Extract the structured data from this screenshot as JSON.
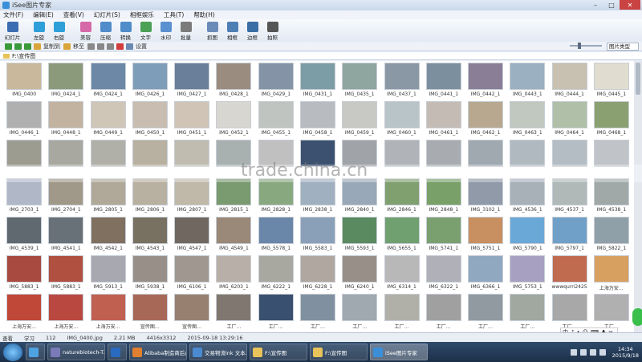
{
  "window": {
    "title": "iSee图片专家"
  },
  "window_buttons": [
    "–",
    "□",
    "✕"
  ],
  "menu": [
    "文件(F)",
    "编辑(E)",
    "查看(V)",
    "幻灯片(S)",
    "相框娱乐",
    "工具(T)",
    "帮助(H)"
  ],
  "toolbar": [
    {
      "label": "幻灯片",
      "color": "#3c6db2"
    },
    {
      "label": "左旋",
      "color": "#2e9fd8"
    },
    {
      "label": "右旋",
      "color": "#2e9fd8"
    },
    {
      "label": "美容",
      "color": "#d66aa8"
    },
    {
      "label": "压缩",
      "color": "#4f8cc9"
    },
    {
      "label": "转换",
      "color": "#4f8cc9"
    },
    {
      "label": "文字",
      "color": "#4aa055"
    },
    {
      "label": "水印",
      "color": "#5a8fd0"
    },
    {
      "label": "批量",
      "color": "#7b7b7b"
    },
    {
      "label": "抓图",
      "color": "#6a8bb8"
    },
    {
      "label": "相框",
      "color": "#4d7fb5"
    },
    {
      "label": "边框",
      "color": "#3a6ea5"
    },
    {
      "label": "拍照",
      "color": "#555"
    }
  ],
  "subtoolbar": [
    {
      "label": "",
      "icon": "back-arrow-icon",
      "color": "#3a9a3a"
    },
    {
      "label": "",
      "icon": "forward-arrow-icon",
      "color": "#3a9a3a"
    },
    {
      "label": "",
      "icon": "up-arrow-icon",
      "color": "#3a9a3a"
    },
    {
      "label": "复制到",
      "icon": "copy-icon",
      "color": "#d9a43a"
    },
    {
      "label": "移至",
      "icon": "move-icon",
      "color": "#d9a43a"
    },
    {
      "label": "",
      "icon": "cut-icon",
      "color": "#888"
    },
    {
      "label": "",
      "icon": "paste-icon",
      "color": "#888"
    },
    {
      "label": "",
      "icon": "copy2-icon",
      "color": "#888"
    },
    {
      "label": "",
      "icon": "delete-icon",
      "color": "#d23c3c"
    },
    {
      "label": "设置",
      "icon": "settings-icon",
      "color": "#6b8ab2"
    }
  ],
  "sort_select": "图片类型",
  "path": "F:\\宣传图",
  "thumbnails": [
    {
      "cap": "IMG_0400",
      "color": "#c9b89b"
    },
    {
      "cap": "IMG_0424_1",
      "color": "#8b9a7a"
    },
    {
      "cap": "IMG_0424_1",
      "color": "#6c88a6"
    },
    {
      "cap": "IMG_0426_1",
      "color": "#7d9db8"
    },
    {
      "cap": "IMG_0427_1",
      "color": "#6a7f9a"
    },
    {
      "cap": "IMG_0428_1",
      "color": "#9a8d80"
    },
    {
      "cap": "IMG_0429_1",
      "color": "#8494a6"
    },
    {
      "cap": "IMG_0431_1",
      "color": "#7d9da6"
    },
    {
      "cap": "IMG_0435_1",
      "color": "#8fa5a0"
    },
    {
      "cap": "IMG_0437_1",
      "color": "#8a98a6"
    },
    {
      "cap": "IMG_0441_1",
      "color": "#7c8f9e"
    },
    {
      "cap": "IMG_0442_1",
      "color": "#8a7d96"
    },
    {
      "cap": "IMG_0443_1",
      "color": "#9bb0c0"
    },
    {
      "cap": "IMG_0444_1",
      "color": "#c8c0b0"
    },
    {
      "cap": "IMG_0445_1",
      "color": "#e0dcd0"
    },
    {
      "cap": "IMG_0446_1",
      "color": "#b0b0b0"
    },
    {
      "cap": "IMG_0448_1",
      "color": "#c2b2a0"
    },
    {
      "cap": "IMG_0449_1",
      "color": "#d0c6b8"
    },
    {
      "cap": "IMG_0450_1",
      "color": "#c8bdb0"
    },
    {
      "cap": "IMG_0451_1",
      "color": "#cfc4b5"
    },
    {
      "cap": "IMG_0452_1",
      "color": "#d8d6d0"
    },
    {
      "cap": "IMG_0455_1",
      "color": "#c0c4c0"
    },
    {
      "cap": "IMG_0458_1",
      "color": "#b8bcc0"
    },
    {
      "cap": "IMG_0459_1",
      "color": "#c8c8c4"
    },
    {
      "cap": "IMG_0460_1",
      "color": "#b8c4c8"
    },
    {
      "cap": "IMG_0461_1",
      "color": "#c4bcb4"
    },
    {
      "cap": "IMG_0462_1",
      "color": "#b8a890"
    },
    {
      "cap": "IMG_0463_1",
      "color": "#c0c8c0"
    },
    {
      "cap": "IMG_0464_1",
      "color": "#b0c0a8"
    },
    {
      "cap": "IMG_0468_1",
      "color": "#8aa070"
    },
    {
      "cap": "",
      "color": "#9c9c90"
    },
    {
      "cap": "",
      "color": "#a8a8a0"
    },
    {
      "cap": "",
      "color": "#b0b0a8"
    },
    {
      "cap": "",
      "color": "#b8b0a0"
    },
    {
      "cap": "",
      "color": "#c0bcb0"
    },
    {
      "cap": "",
      "color": "#a8b0b0"
    },
    {
      "cap": "",
      "color": "#c0c0c0"
    },
    {
      "cap": "",
      "color": "#3c5070"
    },
    {
      "cap": "",
      "color": "#a0a4a8"
    },
    {
      "cap": "",
      "color": "#b0b4b8"
    },
    {
      "cap": "",
      "color": "#a8acb0"
    },
    {
      "cap": "",
      "color": "#a0a8b0"
    },
    {
      "cap": "",
      "color": "#b0b8c0"
    },
    {
      "cap": "",
      "color": "#b4bcc4"
    },
    {
      "cap": "",
      "color": "#c0c4c8"
    },
    {
      "cap": "IMG_2703_1",
      "color": "#b0b8c8"
    },
    {
      "cap": "IMG_2704_1",
      "color": "#a09888"
    },
    {
      "cap": "IMG_2805_1",
      "color": "#b0a898"
    },
    {
      "cap": "IMG_2806_1",
      "color": "#b8b0a0"
    },
    {
      "cap": "IMG_2807_1",
      "color": "#c0b8a8"
    },
    {
      "cap": "IMG_2815_1",
      "color": "#7a9a70"
    },
    {
      "cap": "IMG_2828_1",
      "color": "#88a880"
    },
    {
      "cap": "IMG_2838_1",
      "color": "#a0b0c0"
    },
    {
      "cap": "IMG_2840_1",
      "color": "#98a8b8"
    },
    {
      "cap": "IMG_2846_1",
      "color": "#80a070"
    },
    {
      "cap": "IMG_2848_1",
      "color": "#78a068"
    },
    {
      "cap": "IMG_3102_1",
      "color": "#909aa8"
    },
    {
      "cap": "IMG_4536_1",
      "color": "#a8b0b8"
    },
    {
      "cap": "IMG_4537_1",
      "color": "#b0b8b8"
    },
    {
      "cap": "IMG_4538_1",
      "color": "#a0a8a8"
    },
    {
      "cap": "IMG_4539_1",
      "color": "#606870"
    },
    {
      "cap": "IMG_4541_1",
      "color": "#687078"
    },
    {
      "cap": "IMG_4542_1",
      "color": "#807060"
    },
    {
      "cap": "IMG_4543_1",
      "color": "#787060"
    },
    {
      "cap": "IMG_4547_1",
      "color": "#706860"
    },
    {
      "cap": "IMG_4549_1",
      "color": "#9a8878"
    },
    {
      "cap": "IMG_5578_1",
      "color": "#6a86a8"
    },
    {
      "cap": "IMG_5583_1",
      "color": "#8aa0b8"
    },
    {
      "cap": "IMG_5593_1",
      "color": "#5a8a60"
    },
    {
      "cap": "IMG_5655_1",
      "color": "#70a070"
    },
    {
      "cap": "IMG_5741_1",
      "color": "#7aa070"
    },
    {
      "cap": "IMG_5751_1",
      "color": "#c89060"
    },
    {
      "cap": "IMG_5790_1",
      "color": "#6aa8d8"
    },
    {
      "cap": "IMG_5797_1",
      "color": "#70a0c8"
    },
    {
      "cap": "IMG_5822_1",
      "color": "#90a0a8"
    },
    {
      "cap": "IMG_5883_1",
      "color": "#a84a40"
    },
    {
      "cap": "IMG_5883_1",
      "color": "#b05040"
    },
    {
      "cap": "IMG_5913_1",
      "color": "#a8a8b0"
    },
    {
      "cap": "IMG_5938_1",
      "color": "#989088"
    },
    {
      "cap": "IMG_6106_1",
      "color": "#a09890"
    },
    {
      "cap": "IMG_6203_1",
      "color": "#b8b0a8"
    },
    {
      "cap": "IMG_6222_1",
      "color": "#a8a8a0"
    },
    {
      "cap": "IMG_6228_1",
      "color": "#b0a8a0"
    },
    {
      "cap": "IMG_6240_1",
      "color": "#989088"
    },
    {
      "cap": "IMG_6314_1",
      "color": "#b8b8b8"
    },
    {
      "cap": "IMG_6322_1",
      "color": "#b0b0b8"
    },
    {
      "cap": "IMG_6366_1",
      "color": "#90a8c0"
    },
    {
      "cap": "IMG_5753_1",
      "color": "#a8a0c0"
    },
    {
      "cap": "wwwqurri2425",
      "color": "#c06a50"
    },
    {
      "cap": "上海万安…",
      "color": "#d8a060"
    },
    {
      "cap": "上海万安…",
      "color": "#c04838"
    },
    {
      "cap": "上海万安…",
      "color": "#b84840"
    },
    {
      "cap": "上海万安…",
      "color": "#c06050"
    },
    {
      "cap": "宣传图…",
      "color": "#a86858"
    },
    {
      "cap": "宣传图…",
      "color": "#988070"
    },
    {
      "cap": "工厂…",
      "color": "#807870"
    },
    {
      "cap": "工厂…",
      "color": "#3a5070"
    },
    {
      "cap": "工厂…",
      "color": "#8090a0"
    },
    {
      "cap": "工厂…",
      "color": "#a0a8b0"
    },
    {
      "cap": "工厂…",
      "color": "#b0b0a8"
    },
    {
      "cap": "工厂…",
      "color": "#a0a0a0"
    },
    {
      "cap": "工厂…",
      "color": "#909aa0"
    },
    {
      "cap": "工厂…",
      "color": "#a0a8a0"
    },
    {
      "cap": "工厂…",
      "color": "#a8a8a8"
    },
    {
      "cap": "工厂…",
      "color": "#b0b0b0"
    }
  ],
  "watermark": "trade.china.cn",
  "status": {
    "mode": "查看",
    "study": "学习",
    "count": "112",
    "file": "IMG_0400.jpg",
    "size": "2.21 MB",
    "dims": "4416x3312",
    "date": "2015-09-18 13:29:16"
  },
  "ime": [
    "中",
    "♪",
    "•",
    "☺",
    "⌨",
    "♣",
    "✂"
  ],
  "taskbar": {
    "tasks": [
      {
        "label": "",
        "color": "#4fa2e0"
      },
      {
        "label": "naturebiotech-T...",
        "color": "#7a7ab8"
      },
      {
        "label": "",
        "color": "#2a6ac0"
      },
      {
        "label": "Alibaba制造商后台...",
        "color": "#e08030"
      },
      {
        "label": "交易物流ink 文本...",
        "color": "#4a8ad0"
      },
      {
        "label": "F:\\宣传图",
        "color": "#e8c25a"
      },
      {
        "label": "F:\\宣传图",
        "color": "#e8c25a"
      },
      {
        "label": "iSee图片专家",
        "color": "#3b8fd8"
      }
    ],
    "time": "14:34",
    "date": "2015/9/18"
  }
}
